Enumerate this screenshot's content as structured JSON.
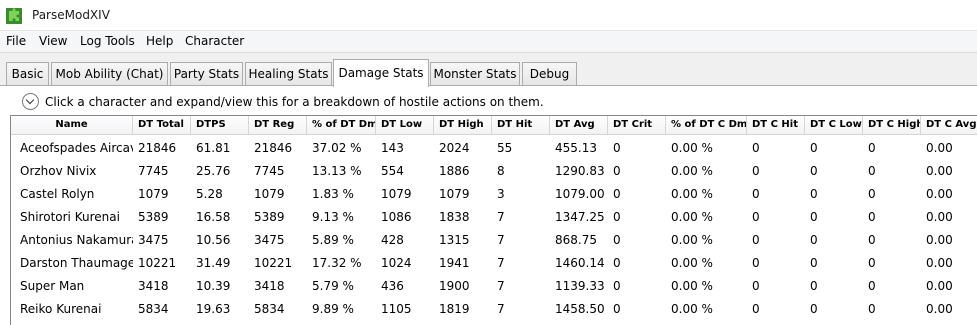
{
  "window": {
    "title": "ParseModXIV",
    "icon": "puzzle-piece-icon"
  },
  "menu": [
    "File",
    "View",
    "Log Tools",
    "Help",
    "Character"
  ],
  "tabs": [
    "Basic",
    "Mob Ability (Chat)",
    "Party Stats",
    "Healing Stats",
    "Damage Stats",
    "Monster Stats",
    "Debug"
  ],
  "active_tab": "Damage Stats",
  "expander": {
    "icon": "chevron-down-icon",
    "text": "Click a character and expand/view this for a breakdown of hostile actions on them."
  },
  "table": {
    "columns": [
      "Name",
      "DT Total",
      "DTPS",
      "DT Reg",
      "% of DT Dmg",
      "DT Low",
      "DT High",
      "DT Hit",
      "DT Avg",
      "DT Crit",
      "% of DT C Dmg",
      "DT C Hit",
      "DT C Low",
      "DT C High",
      "DT C Avg"
    ],
    "rows": [
      [
        "Aceofspades Aircav",
        "21846",
        "61.81",
        "21846",
        "37.02 %",
        "143",
        "2024",
        "55",
        "455.13",
        "0",
        "0.00 %",
        "0",
        "0",
        "0",
        "0.00"
      ],
      [
        "Orzhov Nivix",
        "7745",
        "25.76",
        "7745",
        "13.13 %",
        "554",
        "1886",
        "8",
        "1290.83",
        "0",
        "0.00 %",
        "0",
        "0",
        "0",
        "0.00"
      ],
      [
        "Castel Rolyn",
        "1079",
        "5.28",
        "1079",
        "1.83 %",
        "1079",
        "1079",
        "3",
        "1079.00",
        "0",
        "0.00 %",
        "0",
        "0",
        "0",
        "0.00"
      ],
      [
        "Shirotori Kurenai",
        "5389",
        "16.58",
        "5389",
        "9.13 %",
        "1086",
        "1838",
        "7",
        "1347.25",
        "0",
        "0.00 %",
        "0",
        "0",
        "0",
        "0.00"
      ],
      [
        "Antonius Nakamura",
        "3475",
        "10.56",
        "3475",
        "5.89 %",
        "428",
        "1315",
        "7",
        "868.75",
        "0",
        "0.00 %",
        "0",
        "0",
        "0",
        "0.00"
      ],
      [
        "Darston Thaumage",
        "10221",
        "31.49",
        "10221",
        "17.32 %",
        "1024",
        "1941",
        "7",
        "1460.14",
        "0",
        "0.00 %",
        "0",
        "0",
        "0",
        "0.00"
      ],
      [
        "Super Man",
        "3418",
        "10.39",
        "3418",
        "5.79 %",
        "436",
        "1900",
        "7",
        "1139.33",
        "0",
        "0.00 %",
        "0",
        "0",
        "0",
        "0.00"
      ],
      [
        "Reiko Kurenai",
        "5834",
        "19.63",
        "5834",
        "9.89 %",
        "1105",
        "1819",
        "7",
        "1458.50",
        "0",
        "0.00 %",
        "0",
        "0",
        "0",
        "0.00"
      ]
    ]
  }
}
